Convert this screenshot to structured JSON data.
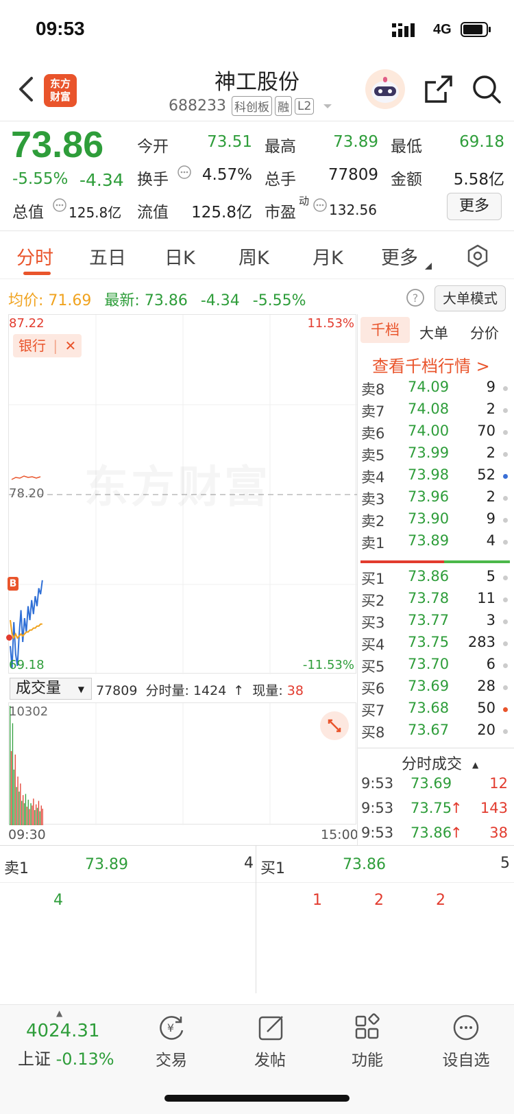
{
  "status_bar": {
    "time": "09:53",
    "network": "4G"
  },
  "header": {
    "logo_text_1": "东方",
    "logo_text_2": "财富",
    "stock_name": "神工股份",
    "stock_code": "688233",
    "tags": [
      "科创板",
      "融",
      "L2"
    ]
  },
  "quote": {
    "price": "73.86",
    "change_pct": "-5.55%",
    "change": "-4.34",
    "stats": {
      "open_label": "今开",
      "open": "73.51",
      "high_label": "最高",
      "high": "73.89",
      "low_label": "最低",
      "low": "69.18",
      "turnover_label": "换手",
      "turnover": "4.57%",
      "volume_label": "总手",
      "volume": "77809",
      "amount_label": "金额",
      "amount": "5.58亿",
      "mktcap_label": "总值",
      "mktcap": "125.8亿",
      "float_label": "流值",
      "float": "125.8亿",
      "pe_label": "市盈",
      "pe_sup": "动",
      "pe": "132.56"
    },
    "more_label": "更多"
  },
  "tabs": [
    "分时",
    "五日",
    "日K",
    "周K",
    "月K",
    "更多"
  ],
  "avg_row": {
    "avg_label": "均价:",
    "avg": "71.69",
    "latest_label": "最新:",
    "latest": "73.86",
    "change": "-4.34",
    "change_pct": "-5.55%"
  },
  "big_order_label": "大单模式",
  "chart": {
    "top_price": "87.22",
    "top_pct": "11.53%",
    "mid_price": "78.20",
    "bottom_price": "69.18",
    "bottom_pct": "-11.53%",
    "sector_tag": "银行",
    "watermark": "东方财富",
    "badge": "B",
    "time_start": "09:30",
    "time_end": "15:00"
  },
  "chart_data": {
    "type": "line",
    "ylim": [
      69.18,
      87.22
    ],
    "series": [
      {
        "values": [
          70.6,
          69.5,
          71.8,
          70.2,
          69.6,
          71.2,
          72.4,
          70.8,
          72.0,
          71.3,
          72.6,
          71.9,
          72.9,
          72.2,
          73.1,
          72.6,
          73.5,
          73.2,
          73.9
        ]
      },
      {
        "values": [
          71.9,
          71.2,
          71.0,
          71.2,
          71.0,
          71.1,
          71.2,
          71.1,
          71.2,
          71.3,
          71.3,
          71.4,
          71.4,
          71.5,
          71.5,
          71.6,
          71.6,
          71.7,
          71.7
        ]
      }
    ]
  },
  "volume": {
    "selector_label": "成交量",
    "total": "77809",
    "minute_label": "分时量:",
    "minute": "1424",
    "now_label": "现量:",
    "now": "38",
    "max": "10302",
    "bars": [
      10302,
      6400,
      8800,
      4800,
      6100,
      3300,
      4200,
      2900,
      3600,
      2100,
      2600,
      1900,
      2700,
      1600,
      2200,
      1400,
      1900,
      1700,
      2300,
      1300,
      1800,
      1500,
      2100,
      1200,
      1700,
      1424
    ],
    "bar_colors": [
      "green",
      "red",
      "green",
      "green",
      "red",
      "green",
      "red",
      "green",
      "red",
      "green",
      "red",
      "green",
      "green",
      "red",
      "green",
      "red",
      "green",
      "red",
      "red",
      "green",
      "red",
      "green",
      "red",
      "green",
      "red",
      "red"
    ]
  },
  "orderbook": {
    "tabs": [
      "千档",
      "大单",
      "分价"
    ],
    "link": "查看千档行情 >",
    "asks": [
      {
        "label": "卖8",
        "price": "74.09",
        "qty": "9",
        "dot": "#cccccc"
      },
      {
        "label": "卖7",
        "price": "74.08",
        "qty": "2",
        "dot": "#cccccc"
      },
      {
        "label": "卖6",
        "price": "74.00",
        "qty": "70",
        "dot": "#cccccc"
      },
      {
        "label": "卖5",
        "price": "73.99",
        "qty": "2",
        "dot": "#cccccc"
      },
      {
        "label": "卖4",
        "price": "73.98",
        "qty": "52",
        "dot": "#3a6fd6"
      },
      {
        "label": "卖3",
        "price": "73.96",
        "qty": "2",
        "dot": "#cccccc"
      },
      {
        "label": "卖2",
        "price": "73.90",
        "qty": "9",
        "dot": "#cccccc"
      },
      {
        "label": "卖1",
        "price": "73.89",
        "qty": "4",
        "dot": "#cccccc"
      }
    ],
    "bids": [
      {
        "label": "买1",
        "price": "73.86",
        "qty": "5",
        "dot": "#cccccc"
      },
      {
        "label": "买2",
        "price": "73.78",
        "qty": "11",
        "dot": "#cccccc"
      },
      {
        "label": "买3",
        "price": "73.77",
        "qty": "3",
        "dot": "#cccccc"
      },
      {
        "label": "买4",
        "price": "73.75",
        "qty": "283",
        "dot": "#cccccc"
      },
      {
        "label": "买5",
        "price": "73.70",
        "qty": "6",
        "dot": "#cccccc"
      },
      {
        "label": "买6",
        "price": "73.69",
        "qty": "28",
        "dot": "#cccccc"
      },
      {
        "label": "买7",
        "price": "73.68",
        "qty": "50",
        "dot": "#e9542b"
      },
      {
        "label": "买8",
        "price": "73.67",
        "qty": "20",
        "dot": "#cccccc"
      }
    ]
  },
  "trades": {
    "title": "分时成交",
    "rows": [
      {
        "time": "9:53",
        "price": "73.69",
        "arrow": "",
        "qty": "12"
      },
      {
        "time": "9:53",
        "price": "73.75",
        "arrow": "↑",
        "qty": "143"
      },
      {
        "time": "9:53",
        "price": "73.86",
        "arrow": "↑",
        "qty": "38"
      }
    ]
  },
  "queue": {
    "sell_label": "卖1",
    "sell_price": "73.89",
    "sell_qty": "4",
    "buy_label": "买1",
    "buy_price": "73.86",
    "buy_qty": "5",
    "sell_orders": [
      "4"
    ],
    "buy_orders": [
      "1",
      "2",
      "2"
    ]
  },
  "bottom_nav": {
    "index_value": "4024.31",
    "index_name": "上证",
    "index_change": "-0.13%",
    "items": [
      "交易",
      "发帖",
      "功能",
      "设自选"
    ]
  },
  "colors": {
    "up": "#e23b2e",
    "down": "#2e9d3a",
    "accent": "#e9542b",
    "avg": "#f0a31f",
    "line": "#2f6fd6"
  }
}
